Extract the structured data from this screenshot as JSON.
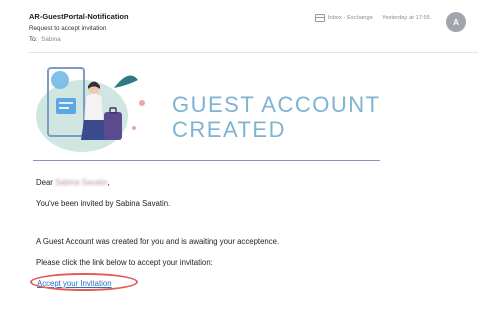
{
  "header": {
    "sender": "AR-GuestPortal-Notification",
    "subject": "Request to accept invitation",
    "to_label": "To:",
    "to_value": "Sabina",
    "mailbox": "Inbox - Exchange",
    "date": "Yesterday at 17:55",
    "avatar_initial": "A"
  },
  "banner": {
    "title_line1": "GUEST ACCOUNT",
    "title_line2": "CREATED",
    "title_color": "#7fb3d1",
    "divider_color": "#9b8bb8"
  },
  "body": {
    "greeting_prefix": "Dear",
    "greeting_name": "Sabina Savatin",
    "greeting_suffix": ",",
    "invited_line": "You've been invited by Sabina Savatin.",
    "created_line": "A Guest Account was created for you and is awaiting your acceptence.",
    "instruction_line": "Please click the link below to accept your invitation:",
    "link_text": "Accept your Invitation",
    "link_color": "#2b6fc2",
    "highlight_color": "#e25a5a"
  }
}
